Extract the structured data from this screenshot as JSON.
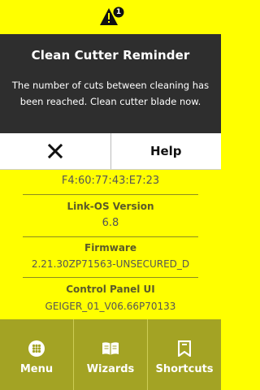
{
  "status_bar": {
    "warning_icon": "warning-icon",
    "notification_count": "1"
  },
  "dialog": {
    "title": "Clean Cutter Reminder",
    "message_line1": "The number of cuts between cleaning has",
    "message_line2": "been reached. Clean cutter blade now."
  },
  "actions": {
    "close_icon": "close-icon",
    "help_label": "Help"
  },
  "info": {
    "mac_address": "F4:60:77:43:E7:23",
    "link_os_label": "Link-OS Version",
    "link_os_value": "6.8",
    "firmware_label": "Firmware",
    "firmware_value": "2.21.30ZP71563-UNSECURED_D",
    "control_panel_label": "Control Panel UI",
    "control_panel_value": "GEIGER_01_V06.66P70133"
  },
  "nav": {
    "menu_label": "Menu",
    "wizards_label": "Wizards",
    "shortcuts_label": "Shortcuts"
  },
  "colors": {
    "accent_yellow": "#ffff00",
    "dialog_bg": "#2e2e2e",
    "nav_bg": "#a3a324"
  }
}
